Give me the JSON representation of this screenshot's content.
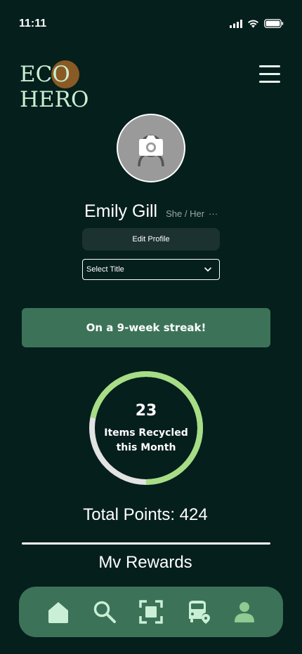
{
  "status_bar": {
    "time": "11:11",
    "icons": [
      "signal-icon",
      "wifi-icon",
      "battery-icon"
    ]
  },
  "header": {
    "logo_text": "ECO HERO",
    "menu_icon": "hamburger-menu-icon"
  },
  "profile": {
    "avatar_icon": "camera-icon",
    "name": "Emily Gill",
    "pronouns": "She / Her",
    "pronouns_more": "···",
    "edit_button_label": "Edit Profile",
    "title_select": {
      "selected": "Select Title",
      "icon": "chevron-down-icon"
    }
  },
  "streak": {
    "label": "On a 9-week streak!"
  },
  "recycle_stats": {
    "count": "23",
    "label_line1": "Items Recycled",
    "label_line2": "this Month",
    "progress_fraction": 0.72
  },
  "points": {
    "total_label": "Total Points: 424"
  },
  "rewards": {
    "heading": "Mv Rewards"
  },
  "bottom_nav": {
    "items": [
      {
        "icon": "home-icon",
        "active": true
      },
      {
        "icon": "search-icon",
        "active": false
      },
      {
        "icon": "scan-icon",
        "active": false
      },
      {
        "icon": "transit-location-icon",
        "active": false
      },
      {
        "icon": "profile-icon",
        "active": false
      }
    ]
  },
  "colors": {
    "background": "#051f1c",
    "accent_green": "#3c7358",
    "ring_progress": "#a6dd85",
    "ring_track": "#e3e3e3",
    "logo_text": "#c9eed2",
    "logo_circle": "#8a5a24",
    "nav_icon": "#c9f0d6",
    "nav_icon_active": "#8fcb92"
  }
}
